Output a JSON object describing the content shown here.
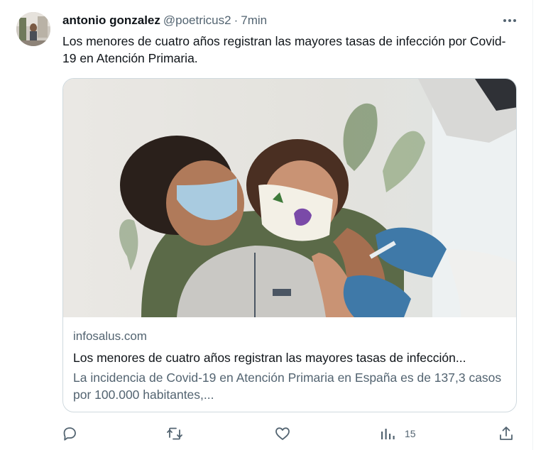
{
  "tweet": {
    "author_name": "antonio gonzalez",
    "author_handle": "@poetricus2",
    "separator": "·",
    "time": "7min",
    "text": "Los menores de cuatro años registran las mayores tasas de infección por Covid-19 en Atención Primaria."
  },
  "card": {
    "domain": "infosalus.com",
    "title": "Los menores de cuatro años registran las mayores tasas de infección...",
    "description": "La incidencia de Covid-19 en Atención Primaria en España es de 137,3 casos por 100.000 habitantes,..."
  },
  "actions": {
    "reply_icon": "reply-icon",
    "retweet_icon": "retweet-icon",
    "like_icon": "heart-icon",
    "views_icon": "views-icon",
    "views_count": "15",
    "share_icon": "share-icon"
  },
  "colors": {
    "text_primary": "#0f1419",
    "text_secondary": "#536471",
    "border": "#cfd9de",
    "mask_blue": "#a9cbe0",
    "glove_blue": "#3f79a8"
  }
}
